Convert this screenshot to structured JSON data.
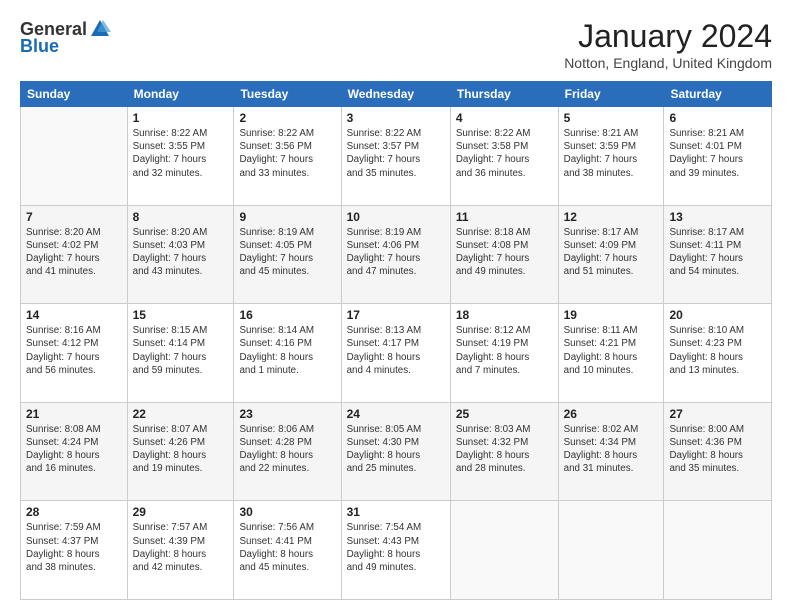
{
  "logo": {
    "general": "General",
    "blue": "Blue"
  },
  "title": "January 2024",
  "subtitle": "Notton, England, United Kingdom",
  "days_of_week": [
    "Sunday",
    "Monday",
    "Tuesday",
    "Wednesday",
    "Thursday",
    "Friday",
    "Saturday"
  ],
  "weeks": [
    [
      {
        "day": "",
        "detail": ""
      },
      {
        "day": "1",
        "detail": "Sunrise: 8:22 AM\nSunset: 3:55 PM\nDaylight: 7 hours\nand 32 minutes."
      },
      {
        "day": "2",
        "detail": "Sunrise: 8:22 AM\nSunset: 3:56 PM\nDaylight: 7 hours\nand 33 minutes."
      },
      {
        "day": "3",
        "detail": "Sunrise: 8:22 AM\nSunset: 3:57 PM\nDaylight: 7 hours\nand 35 minutes."
      },
      {
        "day": "4",
        "detail": "Sunrise: 8:22 AM\nSunset: 3:58 PM\nDaylight: 7 hours\nand 36 minutes."
      },
      {
        "day": "5",
        "detail": "Sunrise: 8:21 AM\nSunset: 3:59 PM\nDaylight: 7 hours\nand 38 minutes."
      },
      {
        "day": "6",
        "detail": "Sunrise: 8:21 AM\nSunset: 4:01 PM\nDaylight: 7 hours\nand 39 minutes."
      }
    ],
    [
      {
        "day": "7",
        "detail": "Sunrise: 8:20 AM\nSunset: 4:02 PM\nDaylight: 7 hours\nand 41 minutes."
      },
      {
        "day": "8",
        "detail": "Sunrise: 8:20 AM\nSunset: 4:03 PM\nDaylight: 7 hours\nand 43 minutes."
      },
      {
        "day": "9",
        "detail": "Sunrise: 8:19 AM\nSunset: 4:05 PM\nDaylight: 7 hours\nand 45 minutes."
      },
      {
        "day": "10",
        "detail": "Sunrise: 8:19 AM\nSunset: 4:06 PM\nDaylight: 7 hours\nand 47 minutes."
      },
      {
        "day": "11",
        "detail": "Sunrise: 8:18 AM\nSunset: 4:08 PM\nDaylight: 7 hours\nand 49 minutes."
      },
      {
        "day": "12",
        "detail": "Sunrise: 8:17 AM\nSunset: 4:09 PM\nDaylight: 7 hours\nand 51 minutes."
      },
      {
        "day": "13",
        "detail": "Sunrise: 8:17 AM\nSunset: 4:11 PM\nDaylight: 7 hours\nand 54 minutes."
      }
    ],
    [
      {
        "day": "14",
        "detail": "Sunrise: 8:16 AM\nSunset: 4:12 PM\nDaylight: 7 hours\nand 56 minutes."
      },
      {
        "day": "15",
        "detail": "Sunrise: 8:15 AM\nSunset: 4:14 PM\nDaylight: 7 hours\nand 59 minutes."
      },
      {
        "day": "16",
        "detail": "Sunrise: 8:14 AM\nSunset: 4:16 PM\nDaylight: 8 hours\nand 1 minute."
      },
      {
        "day": "17",
        "detail": "Sunrise: 8:13 AM\nSunset: 4:17 PM\nDaylight: 8 hours\nand 4 minutes."
      },
      {
        "day": "18",
        "detail": "Sunrise: 8:12 AM\nSunset: 4:19 PM\nDaylight: 8 hours\nand 7 minutes."
      },
      {
        "day": "19",
        "detail": "Sunrise: 8:11 AM\nSunset: 4:21 PM\nDaylight: 8 hours\nand 10 minutes."
      },
      {
        "day": "20",
        "detail": "Sunrise: 8:10 AM\nSunset: 4:23 PM\nDaylight: 8 hours\nand 13 minutes."
      }
    ],
    [
      {
        "day": "21",
        "detail": "Sunrise: 8:08 AM\nSunset: 4:24 PM\nDaylight: 8 hours\nand 16 minutes."
      },
      {
        "day": "22",
        "detail": "Sunrise: 8:07 AM\nSunset: 4:26 PM\nDaylight: 8 hours\nand 19 minutes."
      },
      {
        "day": "23",
        "detail": "Sunrise: 8:06 AM\nSunset: 4:28 PM\nDaylight: 8 hours\nand 22 minutes."
      },
      {
        "day": "24",
        "detail": "Sunrise: 8:05 AM\nSunset: 4:30 PM\nDaylight: 8 hours\nand 25 minutes."
      },
      {
        "day": "25",
        "detail": "Sunrise: 8:03 AM\nSunset: 4:32 PM\nDaylight: 8 hours\nand 28 minutes."
      },
      {
        "day": "26",
        "detail": "Sunrise: 8:02 AM\nSunset: 4:34 PM\nDaylight: 8 hours\nand 31 minutes."
      },
      {
        "day": "27",
        "detail": "Sunrise: 8:00 AM\nSunset: 4:36 PM\nDaylight: 8 hours\nand 35 minutes."
      }
    ],
    [
      {
        "day": "28",
        "detail": "Sunrise: 7:59 AM\nSunset: 4:37 PM\nDaylight: 8 hours\nand 38 minutes."
      },
      {
        "day": "29",
        "detail": "Sunrise: 7:57 AM\nSunset: 4:39 PM\nDaylight: 8 hours\nand 42 minutes."
      },
      {
        "day": "30",
        "detail": "Sunrise: 7:56 AM\nSunset: 4:41 PM\nDaylight: 8 hours\nand 45 minutes."
      },
      {
        "day": "31",
        "detail": "Sunrise: 7:54 AM\nSunset: 4:43 PM\nDaylight: 8 hours\nand 49 minutes."
      },
      {
        "day": "",
        "detail": ""
      },
      {
        "day": "",
        "detail": ""
      },
      {
        "day": "",
        "detail": ""
      }
    ]
  ]
}
